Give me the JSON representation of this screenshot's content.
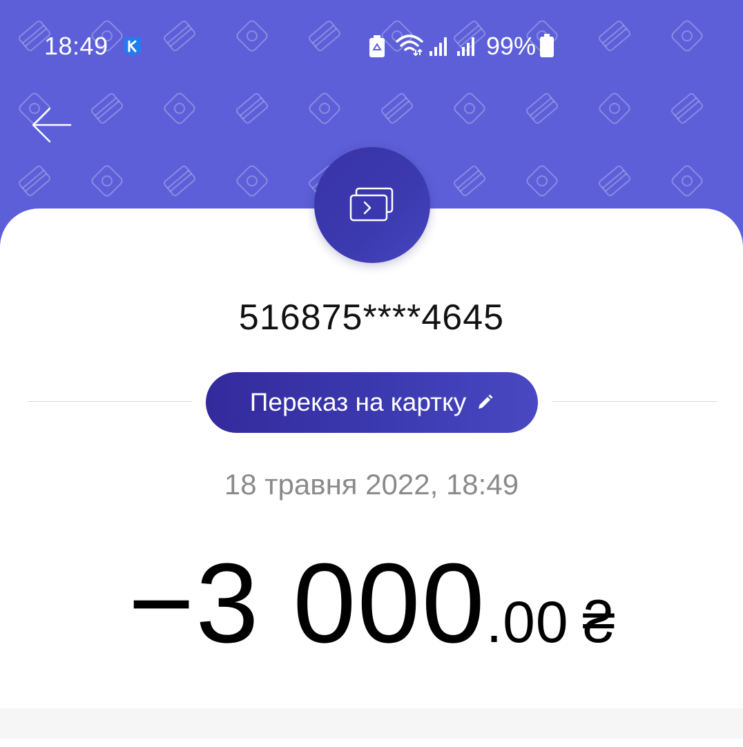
{
  "status_bar": {
    "time": "18:49",
    "battery": "99%",
    "icons": [
      "kyivstar-icon",
      "battery-saver-icon",
      "wifi-icon",
      "signal-icon",
      "signal-icon",
      "battery-icon"
    ]
  },
  "header": {
    "back_icon": "arrow-left-icon",
    "background_color": "#5c5fd8"
  },
  "transaction": {
    "icon": "card-transfer-icon",
    "card_number": "516875****4645",
    "category": "Переказ на картку",
    "category_edit_icon": "pencil-icon",
    "datetime": "18 травня 2022, 18:49",
    "amount_integer": "−3 000",
    "amount_decimal": ".00",
    "currency": "₴",
    "accent_color": "#3b37ad"
  }
}
